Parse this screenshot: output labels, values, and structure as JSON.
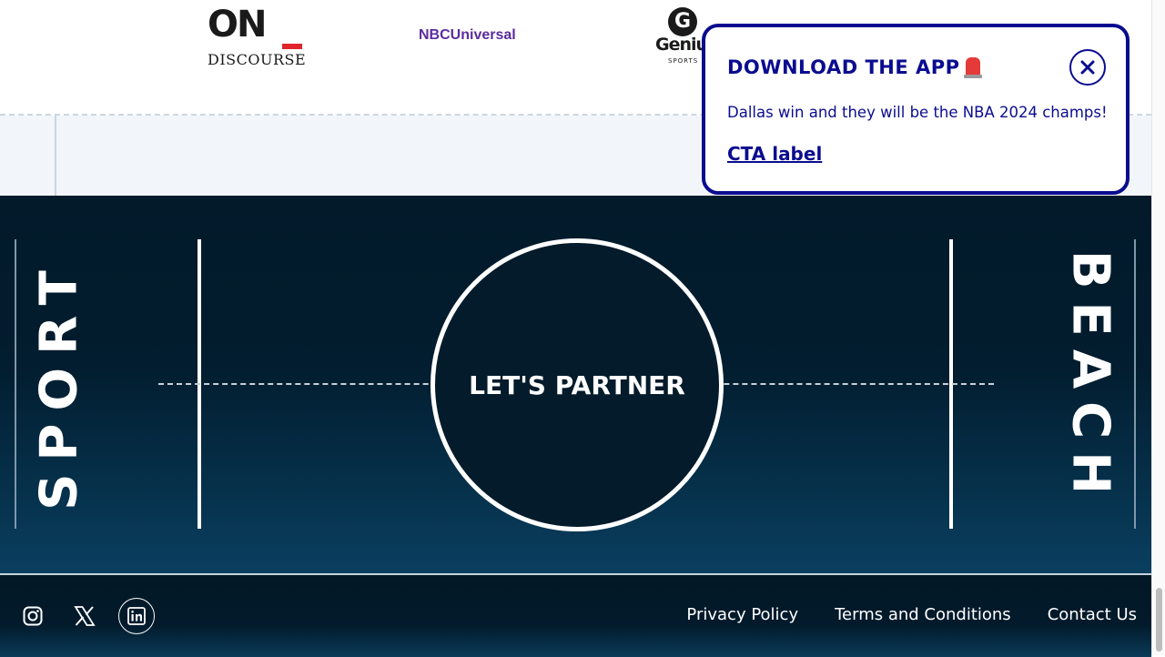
{
  "partners": {
    "on_discourse": {
      "top": "ON",
      "bottom": "DISCOURSE"
    },
    "nbcuniversal": "NBCUniversal",
    "genius": {
      "mark": "G",
      "name": "Geniu",
      "sub": "SPORTS"
    }
  },
  "court": {
    "left_word": "SPORT",
    "right_word": "BEACH",
    "center_label": "LET'S PARTNER"
  },
  "footer": {
    "social": [
      "instagram-icon",
      "x-icon",
      "linkedin-icon"
    ],
    "links": [
      "Privacy Policy",
      "Terms and Conditions",
      "Contact Us"
    ]
  },
  "popup": {
    "title": "DOWNLOAD THE APP",
    "message": "Dallas win and they will be the NBA 2024 champs!",
    "cta": "CTA label",
    "close_icon": "close-icon"
  },
  "colors": {
    "popup_accent": "#0a0c8f",
    "court_dark": "#021a2a",
    "nbc_purple": "#5b2c9e",
    "on_red": "#e0242b"
  }
}
